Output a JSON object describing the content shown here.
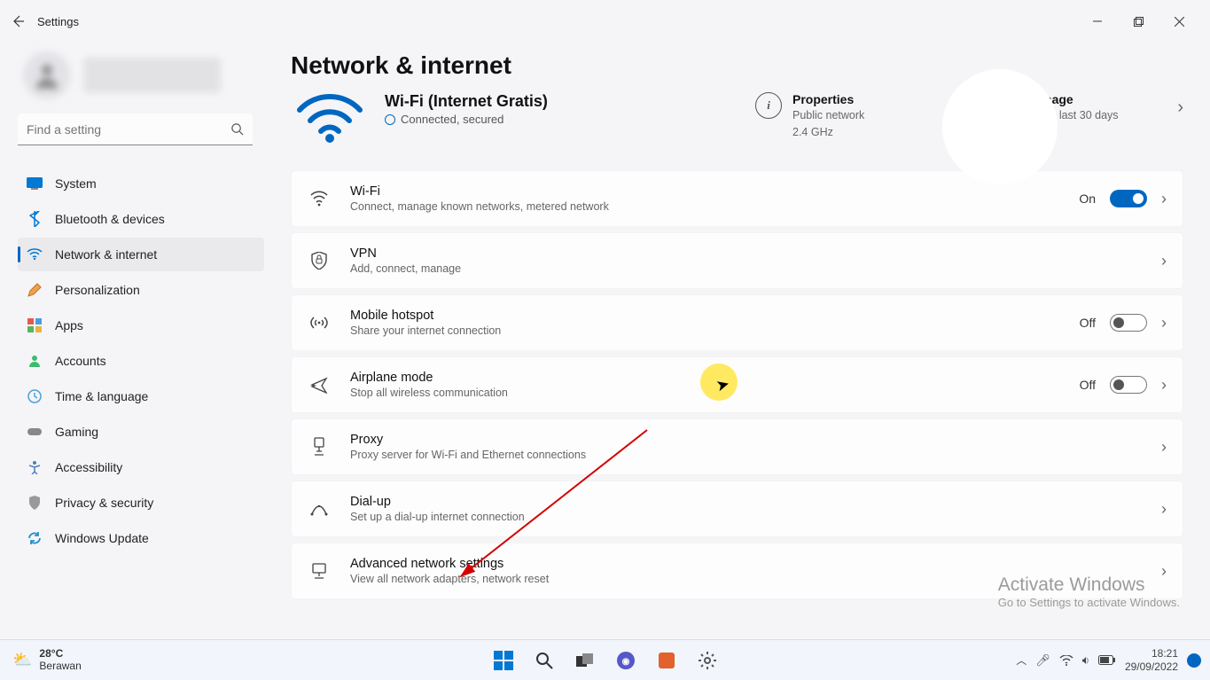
{
  "app_title": "Settings",
  "search_placeholder": "Find a setting",
  "page_title": "Network & internet",
  "nav": {
    "system": "System",
    "bluetooth": "Bluetooth & devices",
    "network": "Network & internet",
    "personalization": "Personalization",
    "apps": "Apps",
    "accounts": "Accounts",
    "time": "Time & language",
    "gaming": "Gaming",
    "accessibility": "Accessibility",
    "privacy": "Privacy & security",
    "update": "Windows Update"
  },
  "connection": {
    "name": "Wi-Fi (Internet Gratis)",
    "status": "Connected, secured"
  },
  "properties": {
    "heading": "Properties",
    "line1": "Public network",
    "line2": "2.4 GHz"
  },
  "data_usage": {
    "heading": "Data usage",
    "line1": "11.39 GB, last 30 days"
  },
  "cards": {
    "wifi": {
      "title": "Wi-Fi",
      "subtitle": "Connect, manage known networks, metered network",
      "state": "On"
    },
    "vpn": {
      "title": "VPN",
      "subtitle": "Add, connect, manage"
    },
    "hotspot": {
      "title": "Mobile hotspot",
      "subtitle": "Share your internet connection",
      "state": "Off"
    },
    "airplane": {
      "title": "Airplane mode",
      "subtitle": "Stop all wireless communication",
      "state": "Off"
    },
    "proxy": {
      "title": "Proxy",
      "subtitle": "Proxy server for Wi-Fi and Ethernet connections"
    },
    "dialup": {
      "title": "Dial-up",
      "subtitle": "Set up a dial-up internet connection"
    },
    "advanced": {
      "title": "Advanced network settings",
      "subtitle": "View all network adapters, network reset"
    }
  },
  "activate": {
    "heading": "Activate Windows",
    "sub": "Go to Settings to activate Windows."
  },
  "taskbar": {
    "temp": "28°C",
    "weather": "Berawan",
    "time": "18:21",
    "date": "29/09/2022"
  }
}
